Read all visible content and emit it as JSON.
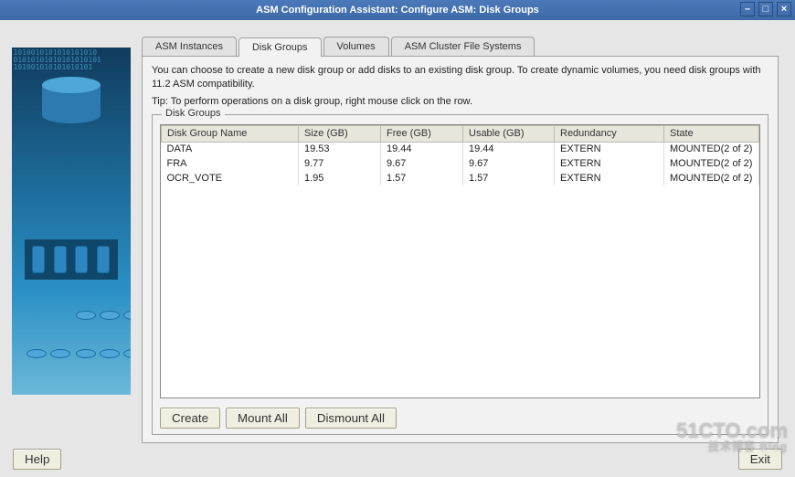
{
  "window": {
    "title": "ASM Configuration Assistant: Configure ASM: Disk Groups"
  },
  "tabs": [
    {
      "label": "ASM Instances"
    },
    {
      "label": "Disk Groups"
    },
    {
      "label": "Volumes"
    },
    {
      "label": "ASM Cluster File Systems"
    }
  ],
  "active_tab_index": 1,
  "instructions": {
    "line1": "You can choose to create a new disk group or add disks to an existing disk group. To create dynamic volumes, you need disk groups with 11.2 ASM compatibility.",
    "line2": "Tip: To perform operations on a disk group, right mouse click on the row."
  },
  "group_label": "Disk Groups",
  "columns": {
    "name": "Disk Group Name",
    "size": "Size (GB)",
    "free": "Free (GB)",
    "usable": "Usable (GB)",
    "redundancy": "Redundancy",
    "state": "State"
  },
  "rows": [
    {
      "name": "DATA",
      "size": "19.53",
      "free": "19.44",
      "usable": "19.44",
      "redundancy": "EXTERN",
      "state": "MOUNTED(2 of 2)"
    },
    {
      "name": "FRA",
      "size": "9.77",
      "free": "9.67",
      "usable": "9.67",
      "redundancy": "EXTERN",
      "state": "MOUNTED(2 of 2)"
    },
    {
      "name": "OCR_VOTE",
      "size": "1.95",
      "free": "1.57",
      "usable": "1.57",
      "redundancy": "EXTERN",
      "state": "MOUNTED(2 of 2)"
    }
  ],
  "buttons": {
    "create": "Create",
    "mount_all": "Mount All",
    "dismount_all": "Dismount All"
  },
  "footer": {
    "help": "Help",
    "exit": "Exit"
  },
  "watermark": {
    "main": "51CTO.com",
    "sub": "技术博客  Blog"
  }
}
